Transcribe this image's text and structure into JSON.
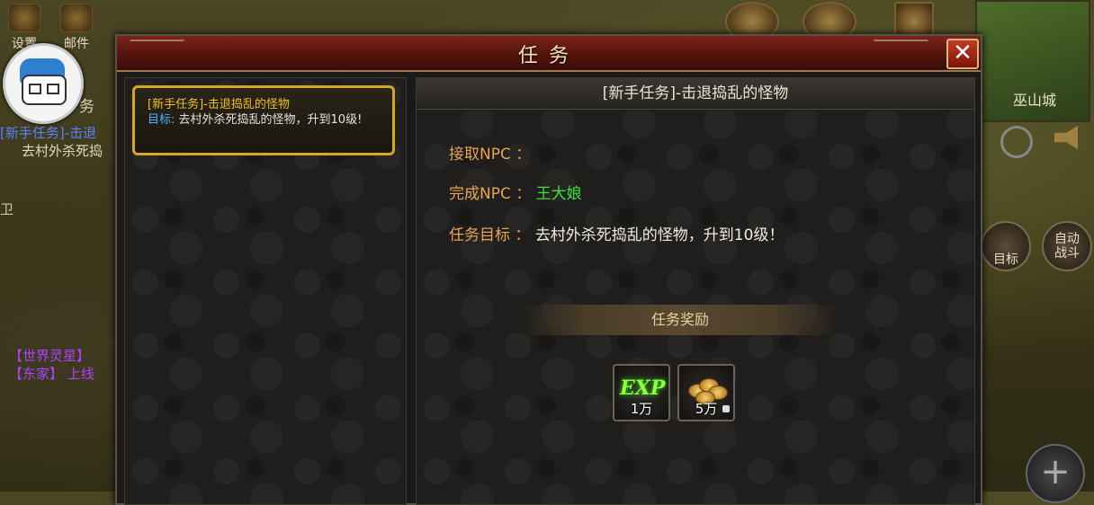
{
  "hud": {
    "settings_label": "设置",
    "mail_label": "邮件",
    "left_tag": "务",
    "side_quest_line1": "[新手任务]-击退",
    "side_quest_line2": "去村外杀死捣",
    "side_text": "卫",
    "chat_line1": "【世界灵星】",
    "chat_line2": "【东家】 上线",
    "city_name": "巫山城",
    "target_label": "目标",
    "auto_battle_label": "自动\n战斗",
    "plus_label": "+"
  },
  "dialog": {
    "title": "任务",
    "close_label": "✕"
  },
  "quest_list": [
    {
      "name": "[新手任务]-击退捣乱的怪物",
      "goal_label": "目标:",
      "goal_text": "去村外杀死捣乱的怪物，升到10级!"
    }
  ],
  "detail": {
    "header": "[新手任务]-击退捣乱的怪物",
    "accept_npc_label": "接取NPC ：",
    "accept_npc_value": "",
    "complete_npc_label": "完成NPC ：",
    "complete_npc_value": "王大娘",
    "objective_label": "任务目标 ：",
    "objective_value": "去村外杀死捣乱的怪物，升到10级！",
    "reward_title": "任务奖励",
    "rewards": [
      {
        "icon": "exp-icon",
        "icon_text": "EXP",
        "amount": "1万"
      },
      {
        "icon": "coins-icon",
        "amount": "5万"
      }
    ]
  },
  "colors": {
    "title_bar": "#5a160e",
    "quest_name": "#f0c020",
    "goal_label": "#4ab0ff",
    "field_label": "#e8a450",
    "npc_value": "#3ee03a",
    "card_border": "#d4a820"
  }
}
